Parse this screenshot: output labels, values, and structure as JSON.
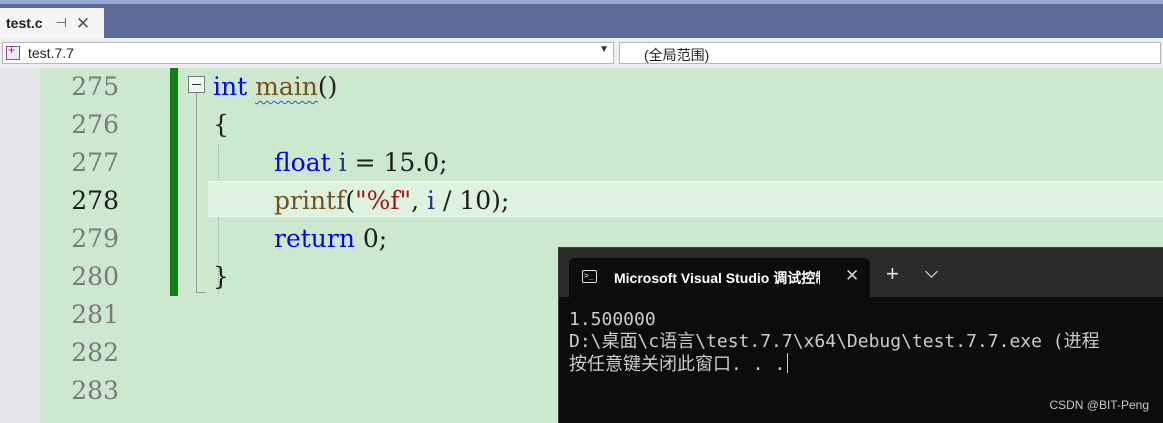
{
  "tab": {
    "filename": "test.c",
    "pin_icon": "⊣",
    "close_icon": "✕"
  },
  "navbar": {
    "project": "test.7.7",
    "scope": "(全局范围)"
  },
  "editor": {
    "line_numbers": [
      "275",
      "276",
      "277",
      "278",
      "279",
      "280",
      "281",
      "282",
      "283"
    ],
    "current_line": "278",
    "code": {
      "l275_kw": "int",
      "l275_fn": "main",
      "l275_rest": "()",
      "l276": "{",
      "l277_kw": "float",
      "l277_var": "i",
      "l277_rest": " = 15.0;",
      "l278_fn": "printf",
      "l278_p1": "(",
      "l278_str": "\"%f\"",
      "l278_p2": ", ",
      "l278_var": "i",
      "l278_rest": " / 10);",
      "l279_kw": "return",
      "l279_rest": " 0;",
      "l280": "}"
    }
  },
  "console": {
    "tab_title": "Microsoft Visual Studio 调试控制台",
    "close_icon": "✕",
    "plus_icon": "+",
    "output": [
      "1.500000",
      "D:\\桌面\\c语言\\test.7.7\\x64\\Debug\\test.7.7.exe (进程",
      "按任意键关闭此窗口. . ."
    ]
  },
  "watermark": "CSDN @BIT-Peng"
}
